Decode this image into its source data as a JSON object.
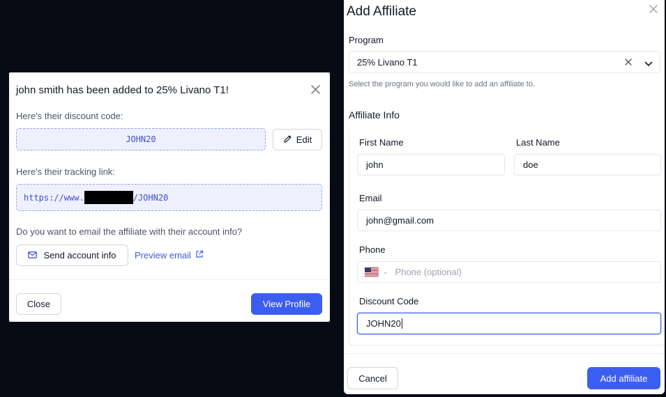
{
  "success_modal": {
    "title": "john smith has been added to 25% Livano T1!",
    "discount_label": "Here's their discount code:",
    "discount_code": "JOHN20",
    "edit_label": "Edit",
    "tracking_label": "Here's their tracking link:",
    "tracking_prefix": "https://www.",
    "tracking_suffix": "/JOHN20",
    "email_question": "Do you want to email the affiliate with their account info?",
    "send_label": "Send account info",
    "preview_label": "Preview email",
    "close_label": "Close",
    "view_profile_label": "View Profile"
  },
  "add_modal": {
    "title": "Add Affiliate",
    "program_label": "Program",
    "program_value": "25% Livano T1",
    "program_helper": "Select the program you would like to add an affiliate to.",
    "section_title": "Affiliate Info",
    "first_name_label": "First Name",
    "first_name_value": "john",
    "last_name_label": "Last Name",
    "last_name_value": "doe",
    "email_label": "Email",
    "email_value": "john@gmail.com",
    "phone_label": "Phone",
    "phone_placeholder": "Phone (optional)",
    "discount_label": "Discount Code",
    "discount_value": "JOHN20",
    "cancel_label": "Cancel",
    "add_label": "Add affiliate"
  },
  "colors": {
    "accent": "#3c5ef0",
    "code_bg": "#eef1fd",
    "code_text": "#3b4ed0",
    "backdrop": "#070b16"
  },
  "icons": [
    "close-icon",
    "pencil-icon",
    "mail-icon",
    "external-link-icon",
    "chevron-down-icon",
    "us-flag-icon"
  ]
}
